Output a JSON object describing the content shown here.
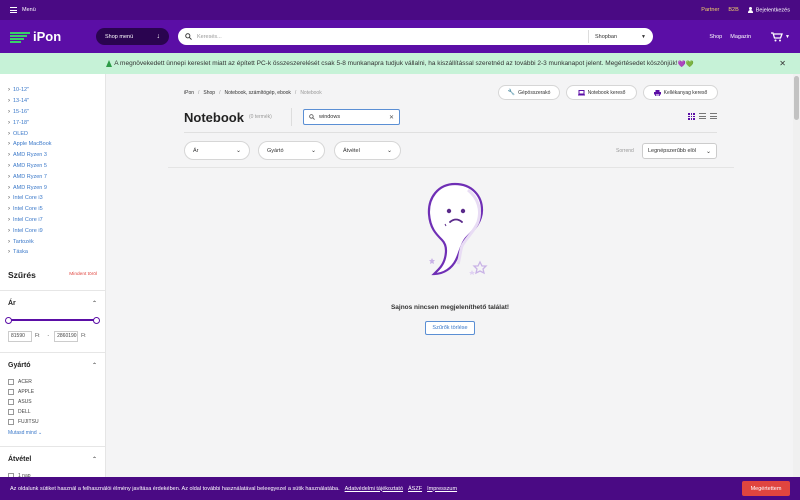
{
  "topbar": {
    "menu_label": "Menü",
    "partner": "Partner",
    "b2b": "B2B",
    "login": "Bejelentkezés"
  },
  "header": {
    "logo_text": "iPon",
    "shop_menu": "Shop menü",
    "search_placeholder": "Keresés...",
    "search_scope": "Shopban",
    "links": [
      "Shop",
      "Magazin"
    ],
    "cart_icon": "cart-icon",
    "brand_color": "#5b0ea6",
    "accent_green": "#3ad06a"
  },
  "notice": {
    "text": "A megnövekedett ünnepi kereslet miatt az épített PC-k összeszerelését csak 5-8 munkanapra tudjuk vállalni, ha kiszállítással szeretnéd az további 2-3 munkanapot jelent. Megértésedet köszönjük!",
    "hearts": "💜💚"
  },
  "sidebar": {
    "categories": [
      "10-12\"",
      "13-14\"",
      "15-16\"",
      "17-18\"",
      "OLED",
      "Apple MacBook",
      "AMD Ryzen 3",
      "AMD Ryzen 5",
      "AMD Ryzen 7",
      "AMD Ryzen 9",
      "Intel Core i3",
      "Intel Core i5",
      "Intel Core i7",
      "Intel Core i9",
      "Tartozék",
      "Táska"
    ],
    "filter_title": "Szűrés",
    "clear_all": "Mindent töröl",
    "price_title": "Ár",
    "price_min": "81590",
    "price_max": "2860190",
    "currency": "Ft",
    "price_dash": "-",
    "brand_title": "Gyártó",
    "brands": [
      "ACER",
      "APPLE",
      "ASUS",
      "DELL",
      "FUJITSU"
    ],
    "show_all": "Mutasd mind",
    "delivery_title": "Átvétel",
    "delivery_options": [
      "1 nap"
    ]
  },
  "main": {
    "breadcrumb": [
      "iPon",
      "Shop",
      "Notebook, számítógép, ebook",
      "Notebook"
    ],
    "toolbar_buttons": [
      {
        "label": "Gépösszerakó",
        "icon": "wrench-icon"
      },
      {
        "label": "Notebook kereső",
        "icon": "laptop-icon"
      },
      {
        "label": "Kellékanyag kereső",
        "icon": "printer-icon"
      }
    ],
    "title": "Notebook",
    "count": "(0 termék)",
    "query": "windows",
    "filters": [
      "Ár",
      "Gyártó",
      "Átvétel"
    ],
    "sort_label": "Sorrend",
    "sort_value": "Legnépszerűbb elöl",
    "empty_message": "Sajnos nincsen megjeleníthető találat!",
    "reset_button": "Szűrők törlése"
  },
  "cookie": {
    "text": "Az oldalunk sütiket használ a felhasználói élmény javítása érdekében. Az oldal további használatával beleegyezel a sütik használatába.",
    "links": [
      "Adatvédelmi tájékoztató",
      "ÁSZF",
      "Impresszum"
    ],
    "accept": "Megértettem"
  }
}
